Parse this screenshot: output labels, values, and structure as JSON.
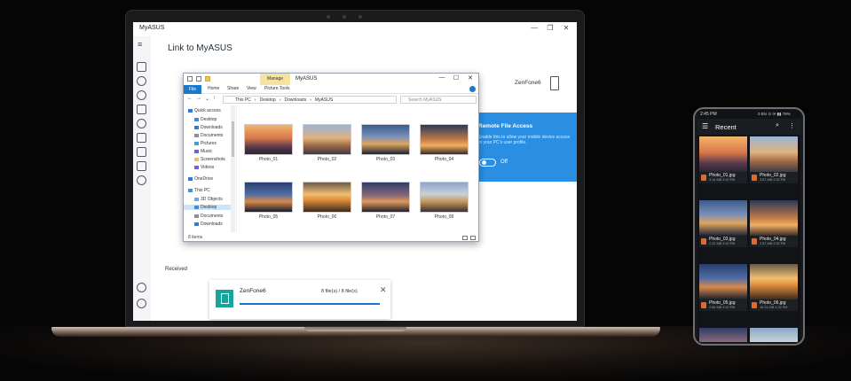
{
  "app": {
    "title": "MyASUS",
    "page_title": "Link to MyASUS",
    "window_controls": [
      "—",
      "❐",
      "✕"
    ],
    "menu_icon": "hamburger-icon",
    "device_name": "ZenFone6",
    "sidebar_icons": [
      "home-icon",
      "bell-icon",
      "headset-icon",
      "refresh-icon",
      "rocket-icon",
      "bag-icon",
      "news-icon",
      "link-icon",
      "user-icon",
      "gear-icon"
    ],
    "remote_file_access": {
      "title": "Remote File Access",
      "description": "Enable this to allow your mobile device access to your PC's user profile.",
      "toggle_label": "Off"
    },
    "received_label": "Received",
    "transfer": {
      "name": "ZenFone6",
      "count": "8 file(s) / 8 file(s)",
      "close": "✕",
      "progress": 1.0
    }
  },
  "explorer": {
    "title": "MyASUS",
    "manage_tab": "Manage",
    "ribbon_tabs": [
      "File",
      "Home",
      "Share",
      "View",
      "Picture Tools"
    ],
    "window_controls": [
      "—",
      "☐",
      "✕"
    ],
    "nav_arrows": [
      "←",
      "→",
      "⌄",
      "↑"
    ],
    "address": [
      "This PC",
      "›",
      "Desktop",
      "›",
      "Downloads",
      "›",
      "MyASUS"
    ],
    "search_placeholder": "Search MyASUS",
    "nav_items": [
      {
        "label": "Quick access",
        "color": "#2f7bd6"
      },
      {
        "label": "Desktop",
        "color": "#3b8de0"
      },
      {
        "label": "Downloads",
        "color": "#2f7bd6"
      },
      {
        "label": "Documents",
        "color": "#8a8f99"
      },
      {
        "label": "Pictures",
        "color": "#3aa0e6"
      },
      {
        "label": "Music",
        "color": "#5a6bd8"
      },
      {
        "label": "Screenshots",
        "color": "#f2c14e"
      },
      {
        "label": "Videos",
        "color": "#7b5bd8"
      },
      {
        "label": "OneDrive",
        "color": "#2f7bd6"
      },
      {
        "label": "This PC",
        "color": "#4a90d9"
      },
      {
        "label": "3D Objects",
        "color": "#6fa8dc"
      },
      {
        "label": "Desktop",
        "color": "#3b8de0"
      },
      {
        "label": "Documents",
        "color": "#8a8f99"
      },
      {
        "label": "Downloads",
        "color": "#2f7bd6"
      }
    ],
    "files": [
      "Photo_01",
      "Photo_02",
      "Photo_03",
      "Photo_04",
      "Photo_05",
      "Photo_06",
      "Photo_07",
      "Photo_08"
    ],
    "status": "8 items"
  },
  "phone": {
    "time": "2:45 PM",
    "status_right": "0 B/s ⊙ ✉ ▮▮ 78%",
    "menu_icon": "☰",
    "title": "Recent",
    "search_icon": "⌕",
    "more_icon": "⋮",
    "files": [
      {
        "name": "Photo_01.jpg",
        "size": "3.14 MB 2:32 PM"
      },
      {
        "name": "Photo_02.jpg",
        "size": "3.57 MB 2:32 PM"
      },
      {
        "name": "Photo_03.jpg",
        "size": "2.22 MB 2:32 PM"
      },
      {
        "name": "Photo_04.jpg",
        "size": "2.57 MB 2:32 PM"
      },
      {
        "name": "Photo_05.jpg",
        "size": "2.66 MB 2:32 PM"
      },
      {
        "name": "Photo_06.jpg",
        "size": "16.31 MB 2:32 PM"
      }
    ]
  },
  "colors": {
    "accent": "#2a8fe3",
    "teal": "#1aa39a",
    "ribbon_blue": "#1979ca"
  }
}
